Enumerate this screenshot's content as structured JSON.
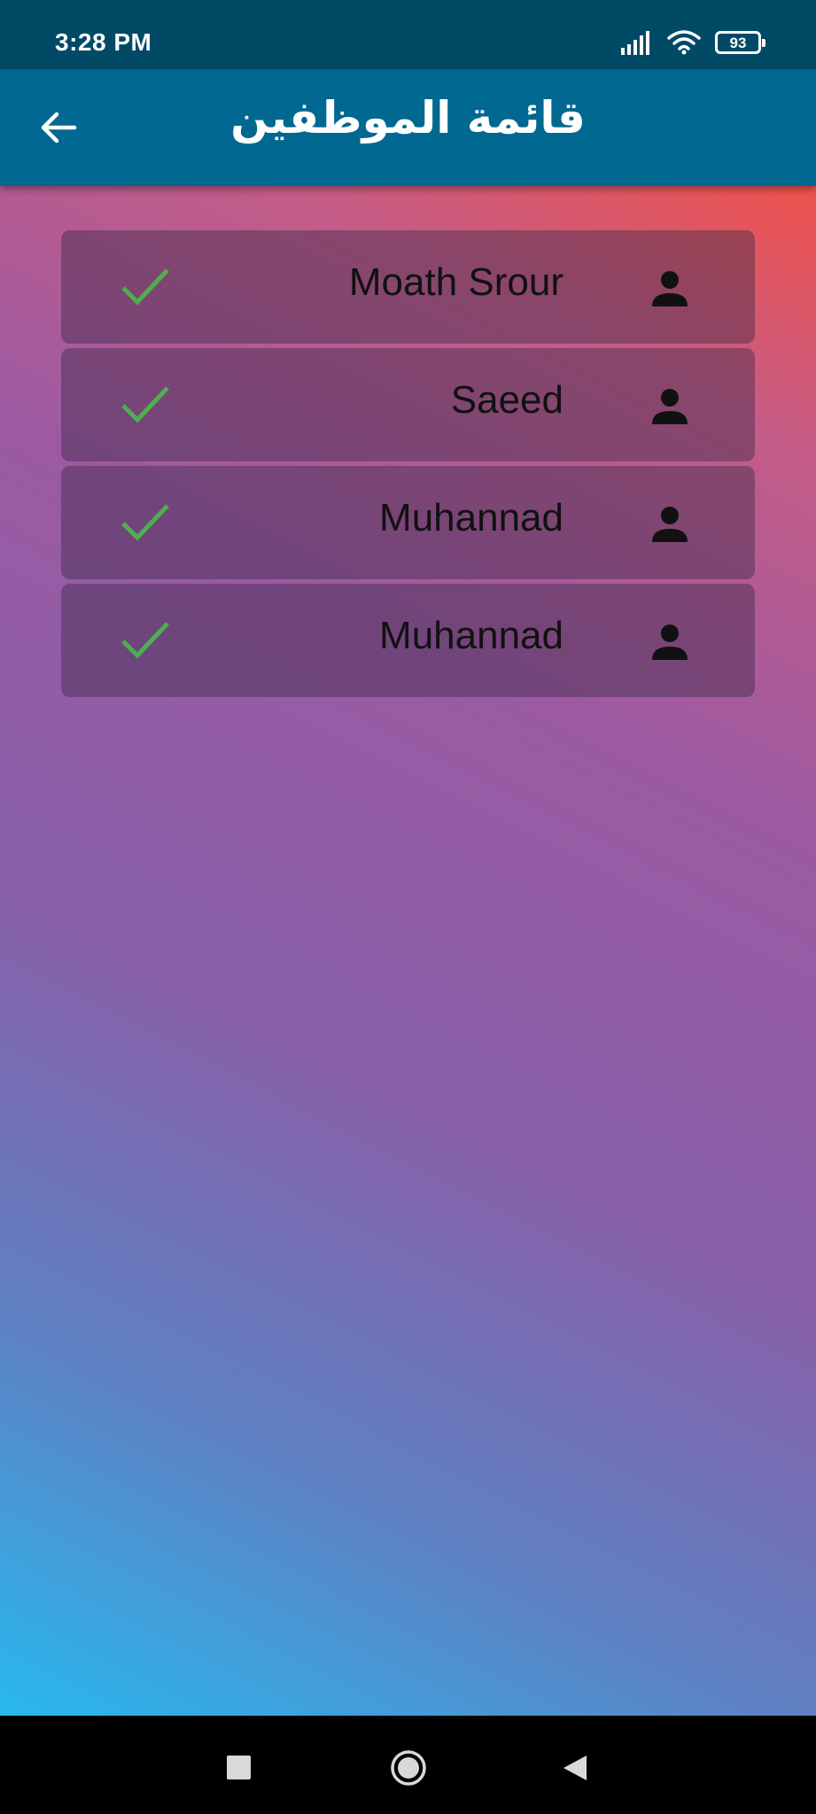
{
  "status_bar": {
    "time": "3:28 PM",
    "battery": "93",
    "icons": [
      "signal-icon",
      "wifi-icon",
      "battery-icon"
    ]
  },
  "app_bar": {
    "title": "قائمة الموظفين",
    "back_icon": "arrow-back-icon"
  },
  "employees": [
    {
      "name": "Moath Srour",
      "status_icon": "check-icon",
      "avatar_icon": "person-icon"
    },
    {
      "name": "Saeed",
      "status_icon": "check-icon",
      "avatar_icon": "person-icon"
    },
    {
      "name": "Muhannad",
      "status_icon": "check-icon",
      "avatar_icon": "person-icon"
    },
    {
      "name": "Muhannad",
      "status_icon": "check-icon",
      "avatar_icon": "person-icon"
    }
  ],
  "nav_bar": {
    "icons": [
      "recents-square-icon",
      "home-circle-icon",
      "back-triangle-icon"
    ]
  },
  "colors": {
    "status_bar": "#004a66",
    "app_bar": "#006891",
    "check": "#4caf50",
    "gradient_top": "#f0534c",
    "gradient_mid": "#9b5aa3",
    "gradient_bottom": "#28b8ee"
  }
}
